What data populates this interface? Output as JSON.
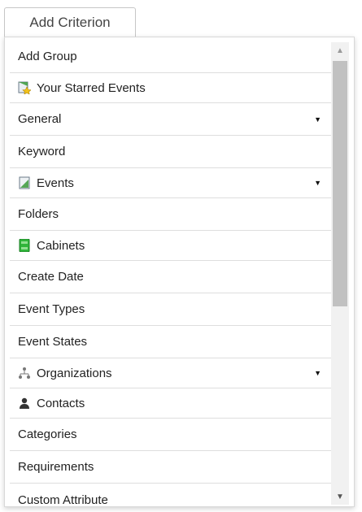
{
  "header": {
    "add_criterion_label": "Add Criterion"
  },
  "menu": {
    "items": [
      {
        "label": "Add Group",
        "icon": null,
        "has_submenu": false
      },
      {
        "label": "Your Starred Events",
        "icon": "starred-events-icon",
        "has_submenu": false
      },
      {
        "label": "General",
        "icon": null,
        "has_submenu": true
      },
      {
        "label": "Keyword",
        "icon": null,
        "has_submenu": false
      },
      {
        "label": "Events",
        "icon": "events-icon",
        "has_submenu": true
      },
      {
        "label": "Folders",
        "icon": null,
        "has_submenu": false
      },
      {
        "label": "Cabinets",
        "icon": "cabinet-icon",
        "has_submenu": false
      },
      {
        "label": "Create Date",
        "icon": null,
        "has_submenu": false
      },
      {
        "label": "Event Types",
        "icon": null,
        "has_submenu": false
      },
      {
        "label": "Event States",
        "icon": null,
        "has_submenu": false
      },
      {
        "label": "Organizations",
        "icon": "organizations-icon",
        "has_submenu": true
      },
      {
        "label": "Contacts",
        "icon": "contact-person-icon",
        "has_submenu": false
      },
      {
        "label": "Categories",
        "icon": null,
        "has_submenu": false
      },
      {
        "label": "Requirements",
        "icon": null,
        "has_submenu": false
      },
      {
        "label": "Custom Attribute",
        "icon": null,
        "has_submenu": false
      }
    ]
  },
  "colors": {
    "cabinet_green": "#2fb53a",
    "star_yellow": "#f2c21b",
    "thumb": "#c1c1c1"
  }
}
